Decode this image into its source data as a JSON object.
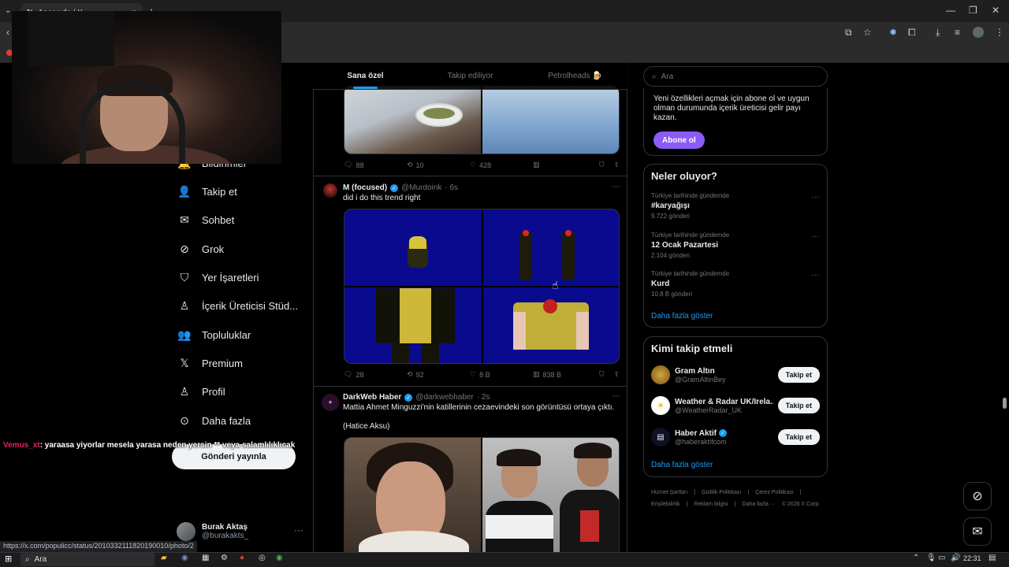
{
  "browser": {
    "tab_title": "Anasayfa / X",
    "tab_close": "×",
    "new_tab": "+",
    "status_url": "https://x.com/populicc/status/2010332111820190010/photo/2"
  },
  "chat_overlay": {
    "user": "Vemus_xt",
    "message": ": yaraasa yiyorlar mesela yarasa neden yersin ** veya salamlılıklıcak"
  },
  "nav": {
    "items": [
      {
        "label": "Bildirimler",
        "icon": "bell-icon"
      },
      {
        "label": "Takip et",
        "icon": "person-add-icon"
      },
      {
        "label": "Sohbet",
        "icon": "envelope-icon"
      },
      {
        "label": "Grok",
        "icon": "grok-icon"
      },
      {
        "label": "Yer İşaretleri",
        "icon": "bookmark-icon"
      },
      {
        "label": "İçerik Üreticisi Stüd...",
        "icon": "creator-studio-icon"
      },
      {
        "label": "Topluluklar",
        "icon": "communities-icon"
      },
      {
        "label": "Premium",
        "icon": "x-logo-icon"
      },
      {
        "label": "Profil",
        "icon": "profile-icon"
      },
      {
        "label": "Daha fazla",
        "icon": "more-circle-icon"
      }
    ],
    "post_button": "Gönderi yayınla",
    "account": {
      "name": "Burak Aktaş",
      "handle": "@burakakts_",
      "more": "···"
    }
  },
  "feed": {
    "tabs": [
      {
        "label": "Sana özel",
        "active": true
      },
      {
        "label": "Takip ediliyor",
        "active": false
      },
      {
        "label": "Petrolheads 🍺",
        "active": false
      }
    ],
    "post0_actions": {
      "replies": "88",
      "reposts": "10",
      "likes": "428"
    },
    "post1": {
      "name": "M (focused)",
      "handle": "@Murdoink",
      "time": "· 6s",
      "text": "did i do this trend right",
      "more": "···",
      "actions": {
        "replies": "28",
        "reposts": "92",
        "likes": "8 B",
        "views": "838 B"
      }
    },
    "post2": {
      "name": "DarkWeb Haber",
      "handle": "@darkwebhaber",
      "time": "· 2s",
      "text": "Mattia Ahmet Minguzzi'nin katillerinin cezaevindeki son görüntüsü ortaya çıktı.",
      "text2": "(Hatice Aksu)",
      "more": "···"
    }
  },
  "sidebar": {
    "search_placeholder": "Ara",
    "premium_text": "Yeni özellikleri açmak için abone ol ve uygun olman durumunda içerik üreticisi gelir payı kazan.",
    "subscribe_button": "Abone ol",
    "trends_title": "Neler oluyor?",
    "trends": [
      {
        "category": "Türkiye tarihinde gündemde",
        "name": "#karyağışı",
        "count": "9.722 gönderi"
      },
      {
        "category": "Türkiye tarihinde gündemde",
        "name": "12 Ocak Pazartesi",
        "count": "2.104 gönderi"
      },
      {
        "category": "Türkiye tarihinde gündemde",
        "name": "Kurd",
        "count": "10,8 B gönderi"
      }
    ],
    "trends_more": "Daha fazla göster",
    "follow_title": "Kimi takip etmeli",
    "follow": [
      {
        "name": "Gram Altın",
        "handle": "@GramAltinBey",
        "button": "Takip et",
        "verified": false,
        "color": "#a67c1e"
      },
      {
        "name": "Weather & Radar UK/Irela...",
        "handle": "@WeatherRadar_UK",
        "button": "Takip et",
        "verified": false,
        "color": "#ffffff"
      },
      {
        "name": "Haber Aktif",
        "handle": "@haberaktifcom",
        "button": "Takip et",
        "verified": true,
        "color": "#1a1a2e"
      }
    ],
    "follow_more": "Daha fazla göster",
    "footer": [
      "Hizmet Şartları",
      "|",
      "Gizlilik Politikası",
      "|",
      "Çerez Politikası",
      "|",
      "Erişilebilirlik",
      "|",
      "Reklam bilgisi",
      "|",
      "Daha fazla ···",
      "© 2026 X Corp."
    ]
  },
  "taskbar": {
    "search": "Ara",
    "time": "22:31"
  },
  "colors": {
    "accent": "#1d9bf0",
    "premium": "#8b5cf6",
    "background": "#000000"
  }
}
